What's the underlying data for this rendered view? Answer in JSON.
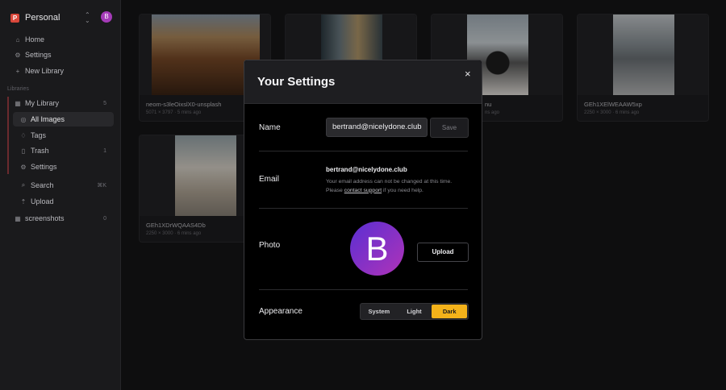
{
  "workspace": {
    "logo_letter": "P",
    "name": "Personal",
    "avatar_letter": "B",
    "chevron": "⌃⌄"
  },
  "nav": [
    {
      "icon": "home-icon",
      "glyph": "⌂",
      "label": "Home"
    },
    {
      "icon": "gear-icon",
      "glyph": "⚙",
      "label": "Settings"
    },
    {
      "icon": "plus-icon",
      "glyph": "+",
      "label": "New Library"
    }
  ],
  "libraries_label": "Libraries",
  "library": {
    "name": "My Library",
    "count": "5",
    "icon": "library-icon",
    "glyph": "▦",
    "items": [
      {
        "icon": "images-icon",
        "glyph": "◎",
        "label": "All Images",
        "active": true
      },
      {
        "icon": "tag-icon",
        "glyph": "♢",
        "label": "Tags"
      },
      {
        "icon": "trash-icon",
        "glyph": "▯",
        "label": "Trash",
        "count": "1"
      },
      {
        "icon": "gear-icon",
        "glyph": "⚙",
        "label": "Settings"
      },
      {
        "icon": "search-icon",
        "glyph": "⌕",
        "label": "Search",
        "shortcut": "⌘K"
      },
      {
        "icon": "upload-icon",
        "glyph": "⇡",
        "label": "Upload"
      }
    ]
  },
  "library2": {
    "name": "screenshots",
    "count": "0",
    "icon": "grid-icon",
    "glyph": "▦"
  },
  "cards": [
    {
      "title": "neom-s3leOixslX0-unsplash",
      "meta": "5071 × 3797  ·  5 mins ago"
    },
    {
      "title": "",
      "meta": ""
    },
    {
      "title": "nu",
      "meta": "ns ago"
    },
    {
      "title": "GEh1XElWEAAW5xp",
      "meta": "2250 × 3000  ·  6 mins ago"
    },
    {
      "title": "GEh1XDrWQAAS4Db",
      "meta": "2250 × 3000  ·  6 mins ago"
    }
  ],
  "modal": {
    "title": "Your Settings",
    "close_icon": "×",
    "name_label": "Name",
    "name_value": "bertrand@nicelydone.club",
    "save_label": "Save",
    "email_label": "Email",
    "email_value": "bertrand@nicelydone.club",
    "email_note_a": "Your email address can not be changed at this time. Please ",
    "email_note_link": "contact support",
    "email_note_b": " if you need help.",
    "photo_label": "Photo",
    "photo_letter": "B",
    "upload_label": "Upload",
    "appearance_label": "Appearance",
    "appearance_options": [
      "System",
      "Light",
      "Dark"
    ],
    "appearance_selected": "Dark"
  },
  "colors": {
    "accent": "#f4b21a",
    "avatar_gradient_start": "#5a2fd3",
    "avatar_gradient_end": "#b033b8",
    "workspace_logo": "#d9473a"
  }
}
